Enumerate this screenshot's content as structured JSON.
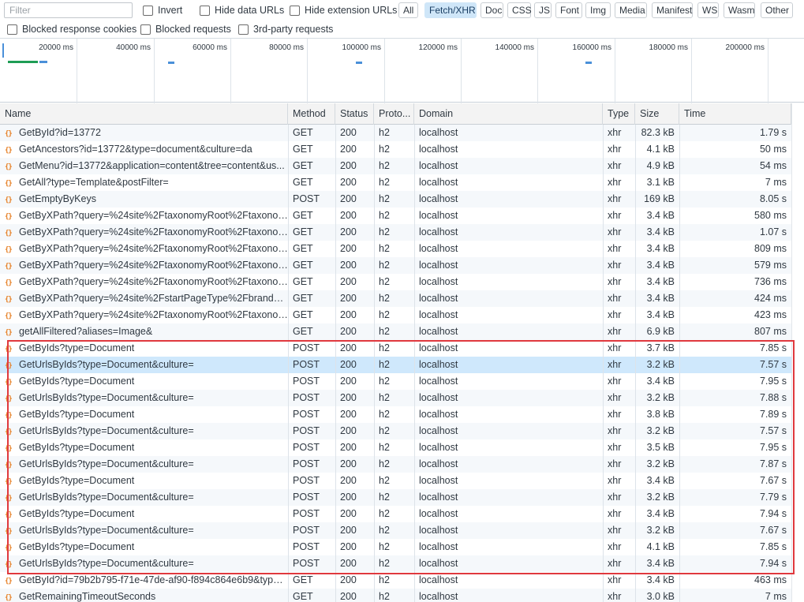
{
  "toolbar": {
    "filter_placeholder": "Filter",
    "invert": "Invert",
    "hide_data_urls": "Hide data URLs",
    "hide_extension_urls": "Hide extension URLs",
    "types": [
      "All",
      "Fetch/XHR",
      "Doc",
      "CSS",
      "JS",
      "Font",
      "Img",
      "Media",
      "Manifest",
      "WS",
      "Wasm",
      "Other"
    ],
    "active_type": "Fetch/XHR",
    "blocked_response_cookies": "Blocked response cookies",
    "blocked_requests": "Blocked requests",
    "third_party_requests": "3rd-party requests"
  },
  "overview": {
    "ticks": [
      "20000 ms",
      "40000 ms",
      "60000 ms",
      "80000 ms",
      "100000 ms",
      "120000 ms",
      "140000 ms",
      "160000 ms",
      "180000 ms",
      "200000 ms"
    ]
  },
  "columns": [
    "Name",
    "Method",
    "Status",
    "Proto...",
    "Domain",
    "Type",
    "Size",
    "Time"
  ],
  "rows": [
    {
      "name": "GetById?id=13772",
      "method": "GET",
      "status": "200",
      "proto": "h2",
      "domain": "localhost",
      "type": "xhr",
      "size": "82.3 kB",
      "time": "1.79 s"
    },
    {
      "name": "GetAncestors?id=13772&type=document&culture=da",
      "method": "GET",
      "status": "200",
      "proto": "h2",
      "domain": "localhost",
      "type": "xhr",
      "size": "4.1 kB",
      "time": "50 ms"
    },
    {
      "name": "GetMenu?id=13772&application=content&tree=content&us...",
      "method": "GET",
      "status": "200",
      "proto": "h2",
      "domain": "localhost",
      "type": "xhr",
      "size": "4.9 kB",
      "time": "54 ms"
    },
    {
      "name": "GetAll?type=Template&postFilter=",
      "method": "GET",
      "status": "200",
      "proto": "h2",
      "domain": "localhost",
      "type": "xhr",
      "size": "3.1 kB",
      "time": "7 ms"
    },
    {
      "name": "GetEmptyByKeys",
      "method": "POST",
      "status": "200",
      "proto": "h2",
      "domain": "localhost",
      "type": "xhr",
      "size": "169 kB",
      "time": "8.05 s"
    },
    {
      "name": "GetByXPath?query=%24site%2FtaxonomyRoot%2Ftaxonomy...",
      "method": "GET",
      "status": "200",
      "proto": "h2",
      "domain": "localhost",
      "type": "xhr",
      "size": "3.4 kB",
      "time": "580 ms"
    },
    {
      "name": "GetByXPath?query=%24site%2FtaxonomyRoot%2Ftaxonomy...",
      "method": "GET",
      "status": "200",
      "proto": "h2",
      "domain": "localhost",
      "type": "xhr",
      "size": "3.4 kB",
      "time": "1.07 s"
    },
    {
      "name": "GetByXPath?query=%24site%2FtaxonomyRoot%2Ftaxonomy...",
      "method": "GET",
      "status": "200",
      "proto": "h2",
      "domain": "localhost",
      "type": "xhr",
      "size": "3.4 kB",
      "time": "809 ms"
    },
    {
      "name": "GetByXPath?query=%24site%2FtaxonomyRoot%2Ftaxonomy...",
      "method": "GET",
      "status": "200",
      "proto": "h2",
      "domain": "localhost",
      "type": "xhr",
      "size": "3.4 kB",
      "time": "579 ms"
    },
    {
      "name": "GetByXPath?query=%24site%2FtaxonomyRoot%2Ftaxonomy...",
      "method": "GET",
      "status": "200",
      "proto": "h2",
      "domain": "localhost",
      "type": "xhr",
      "size": "3.4 kB",
      "time": "736 ms"
    },
    {
      "name": "GetByXPath?query=%24site%2FstartPageType%2FbrandCo...e...",
      "method": "GET",
      "status": "200",
      "proto": "h2",
      "domain": "localhost",
      "type": "xhr",
      "size": "3.4 kB",
      "time": "424 ms"
    },
    {
      "name": "GetByXPath?query=%24site%2FtaxonomyRoot%2Ftaxonomy...",
      "method": "GET",
      "status": "200",
      "proto": "h2",
      "domain": "localhost",
      "type": "xhr",
      "size": "3.4 kB",
      "time": "423 ms"
    },
    {
      "name": "getAllFiltered?aliases=Image&",
      "method": "GET",
      "status": "200",
      "proto": "h2",
      "domain": "localhost",
      "type": "xhr",
      "size": "6.9 kB",
      "time": "807 ms"
    },
    {
      "name": "GetByIds?type=Document",
      "method": "POST",
      "status": "200",
      "proto": "h2",
      "domain": "localhost",
      "type": "xhr",
      "size": "3.7 kB",
      "time": "7.85 s"
    },
    {
      "name": "GetUrlsByIds?type=Document&culture=",
      "method": "POST",
      "status": "200",
      "proto": "h2",
      "domain": "localhost",
      "type": "xhr",
      "size": "3.2 kB",
      "time": "7.57 s",
      "selected": true
    },
    {
      "name": "GetByIds?type=Document",
      "method": "POST",
      "status": "200",
      "proto": "h2",
      "domain": "localhost",
      "type": "xhr",
      "size": "3.4 kB",
      "time": "7.95 s"
    },
    {
      "name": "GetUrlsByIds?type=Document&culture=",
      "method": "POST",
      "status": "200",
      "proto": "h2",
      "domain": "localhost",
      "type": "xhr",
      "size": "3.2 kB",
      "time": "7.88 s"
    },
    {
      "name": "GetByIds?type=Document",
      "method": "POST",
      "status": "200",
      "proto": "h2",
      "domain": "localhost",
      "type": "xhr",
      "size": "3.8 kB",
      "time": "7.89 s"
    },
    {
      "name": "GetUrlsByIds?type=Document&culture=",
      "method": "POST",
      "status": "200",
      "proto": "h2",
      "domain": "localhost",
      "type": "xhr",
      "size": "3.2 kB",
      "time": "7.57 s"
    },
    {
      "name": "GetByIds?type=Document",
      "method": "POST",
      "status": "200",
      "proto": "h2",
      "domain": "localhost",
      "type": "xhr",
      "size": "3.5 kB",
      "time": "7.95 s"
    },
    {
      "name": "GetUrlsByIds?type=Document&culture=",
      "method": "POST",
      "status": "200",
      "proto": "h2",
      "domain": "localhost",
      "type": "xhr",
      "size": "3.2 kB",
      "time": "7.87 s"
    },
    {
      "name": "GetByIds?type=Document",
      "method": "POST",
      "status": "200",
      "proto": "h2",
      "domain": "localhost",
      "type": "xhr",
      "size": "3.4 kB",
      "time": "7.67 s"
    },
    {
      "name": "GetUrlsByIds?type=Document&culture=",
      "method": "POST",
      "status": "200",
      "proto": "h2",
      "domain": "localhost",
      "type": "xhr",
      "size": "3.2 kB",
      "time": "7.79 s"
    },
    {
      "name": "GetByIds?type=Document",
      "method": "POST",
      "status": "200",
      "proto": "h2",
      "domain": "localhost",
      "type": "xhr",
      "size": "3.4 kB",
      "time": "7.94 s"
    },
    {
      "name": "GetUrlsByIds?type=Document&culture=",
      "method": "POST",
      "status": "200",
      "proto": "h2",
      "domain": "localhost",
      "type": "xhr",
      "size": "3.2 kB",
      "time": "7.67 s"
    },
    {
      "name": "GetByIds?type=Document",
      "method": "POST",
      "status": "200",
      "proto": "h2",
      "domain": "localhost",
      "type": "xhr",
      "size": "4.1 kB",
      "time": "7.85 s"
    },
    {
      "name": "GetUrlsByIds?type=Document&culture=",
      "method": "POST",
      "status": "200",
      "proto": "h2",
      "domain": "localhost",
      "type": "xhr",
      "size": "3.4 kB",
      "time": "7.94 s"
    },
    {
      "name": "GetById?id=79b2b795-f71e-47de-af90-f894c864e6b9&type=...",
      "method": "GET",
      "status": "200",
      "proto": "h2",
      "domain": "localhost",
      "type": "xhr",
      "size": "3.4 kB",
      "time": "463 ms"
    },
    {
      "name": "GetRemainingTimeoutSeconds",
      "method": "GET",
      "status": "200",
      "proto": "h2",
      "domain": "localhost",
      "type": "xhr",
      "size": "3.0 kB",
      "time": "7 ms"
    }
  ],
  "colors": {
    "highlight_box": "#e0393e",
    "selected_row": "#cfe8fc",
    "active_pill": "#cfe6f8",
    "xhr_icon": "#e67e22",
    "overview_bar": "#1f9d55",
    "overview_mark": "#4a90d9"
  }
}
